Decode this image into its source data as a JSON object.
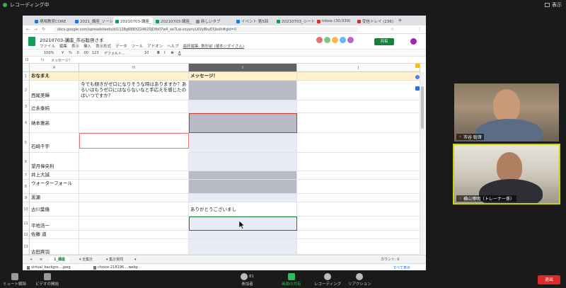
{
  "zoom": {
    "recording_label": "レコーディング中",
    "view_label": "表示",
    "bottom": {
      "mute": "ミュート解除",
      "video": "ビデオの開始",
      "participants": "参加者",
      "participants_count": "81",
      "share": "画面の共有",
      "record": "レコーディング",
      "reactions": "リアクション",
      "leave": "退出"
    }
  },
  "browser": {
    "tabs": [
      {
        "label": "現場教育CORE",
        "color": "#1a73e8"
      },
      {
        "label": "2021_講座_ソーシ",
        "color": "#1a73e8"
      },
      {
        "label": "20210703-講座_",
        "color": "#0f9d58"
      },
      {
        "label": "20210703-講座_",
        "color": "#0f9d58"
      },
      {
        "label": "新しいタブ",
        "color": "#888888"
      },
      {
        "label": "イベント 第5回",
        "color": "#1a73e8"
      },
      {
        "label": "20210703_シートー",
        "color": "#0f9d58"
      },
      {
        "label": "Inbox (30,039)",
        "color": "#d93025"
      },
      {
        "label": "受信トレイ (236)",
        "color": "#d93025"
      }
    ],
    "url": "docs.google.com/spreadsheets/d/1128g6B8XZ2462SJDfb07w4_xe7Lw-zxypnyLKVyBkyEXJedit#gid=0"
  },
  "sheets": {
    "title": "20210703-講座_市谷聡啓さま",
    "menus": [
      "ファイル",
      "編集",
      "表示",
      "挿入",
      "表示形式",
      "データ",
      "ツール",
      "アドオン",
      "ヘルプ",
      "最終編集: 数秒前 (榎本ジダイさん)"
    ],
    "share_label": "共有",
    "toolbar": [
      "100%",
      "¥",
      "%",
      ".0",
      ".00",
      "123",
      "デフォルト...",
      "10",
      "B",
      "I",
      "S",
      "A"
    ],
    "cell_ref": "I1",
    "formula": "メッセージ！",
    "columns": {
      "a": "A",
      "h": "H",
      "i": "I",
      "j": "J"
    },
    "rows": [
      {
        "n": "1",
        "name": "おなまえ",
        "h": "",
        "i": "メッセージ！"
      },
      {
        "n": "2",
        "name": "西尾美輝",
        "h": "今でも傾きがゼロになりそうな時はありますか？あるいはもうゼロにはならないなと手応えを感じたのはいつですか？",
        "i": ""
      },
      {
        "n": "3",
        "name": "辻永泰純",
        "h": "",
        "i": ""
      },
      {
        "n": "4",
        "name": "納本雅高",
        "h": "",
        "i": ""
      },
      {
        "n": "5",
        "name": "石崎千宇",
        "h": "",
        "i": ""
      },
      {
        "n": "6",
        "name": "望月偉央利",
        "h": "",
        "i": ""
      },
      {
        "n": "7",
        "name": "井上大誠",
        "h": "",
        "i": ""
      },
      {
        "n": "8",
        "name": "ウォーターフォール",
        "h": "",
        "i": ""
      },
      {
        "n": "9",
        "name": "黒瀬",
        "h": "",
        "i": ""
      },
      {
        "n": "10",
        "name": "古川葉儀",
        "h": "",
        "i": "ありがとうございまし"
      },
      {
        "n": "11",
        "name": "平地浩一",
        "h": "",
        "i": ""
      },
      {
        "n": "12",
        "name": "佐藤 道",
        "h": "",
        "i": ""
      },
      {
        "n": "13",
        "name": "古田爽羽",
        "h": "",
        "i": ""
      }
    ],
    "sheet_tabs": [
      "+",
      "≡",
      "1_講座",
      "▾ 全集計",
      "▾ 集計質問",
      "▾"
    ],
    "count_label": "カウント: 0"
  },
  "downloads": {
    "items": [
      "virtual_backgro....jpeg",
      "choice-218196....webp"
    ],
    "show_all": "すべて表示"
  },
  "video": {
    "tile1_name": "市谷 聡啓",
    "tile2_name": "横山博明（トレーナー係）"
  }
}
